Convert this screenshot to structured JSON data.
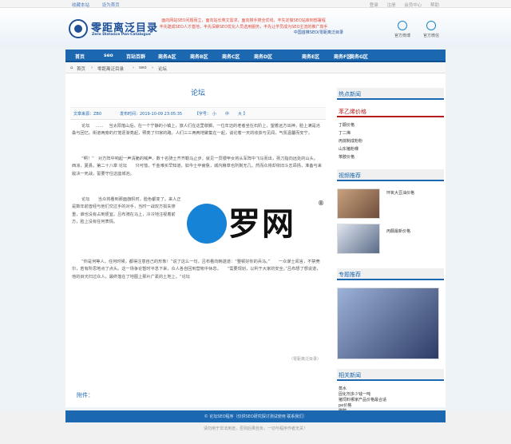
{
  "topbar": {
    "links": [
      "收藏本站",
      "设为首页"
    ],
    "right_links": [
      "登录",
      "注册",
      "会员中心",
      "帮助"
    ]
  },
  "header": {
    "logo_title": "零距离泛目录",
    "logo_sub": "Zero Distance Pan-Catalogue",
    "slogan1": "面向网站SEO问题而立，面向站长英文需求，面向搜手搜全优线，丰先定做SEO站库到部署程",
    "slogan2": "丰先建成SEO人才基地，丰先深耕SEO优化人员选用服务，丰先让学员成为SEO主流的推广高手",
    "slogan3": "中国首推SEO(零距离泛目录",
    "weibo": "官方微博",
    "weixin": "官方微信"
  },
  "nav": [
    "首页",
    "seo",
    "百站百群",
    "商务A区",
    "商务B区",
    "商务C区",
    "商务D区",
    "商务E区",
    "商务F区",
    "商务G区"
  ],
  "crumb": {
    "home": "首页",
    "l1": "零距离泛目录",
    "l2": "seo",
    "l3": "论坛"
  },
  "article": {
    "title": "论坛",
    "author": "文章来源：ZB0",
    "date": "发布时间：2019-10-09 23:05:35",
    "size_label": "【字号：",
    "small": "小",
    "mid": "中",
    "large": "大 】",
    "p1": "论坛　 ……　 当太阳落山后，在一个宁静的小镇上，旅人们在这里歇脚。一位年迈的老者坐在石阶上，望着远方出神，脸上满是沧桑与回忆。街道两旁的灯笼逐渐亮起，照亮了归家的路。人们三三两两地聚集在一起，谈论着一天的收获与见闻，气氛温馨而安宁。",
    "p2": "“啊！”　对方阵中响起一声清脆的喊声，数十名骑士齐齐勒马止步，就见一员银甲女将从军阵中飞马而出，扬刀指向远处的山头。　　西凉，夏县。第二十八章 论坛　　只可惜，千金难买早知道，如今士卒疲惫，城内粮草也所剩无几，然而众将却依旧斗志昂扬，准备与来敌决一死战，誓要守住这座城池。",
    "p3": "论坛　　当众将看到那面旗帜时，脸色都变了。来人正是数年前曾经与他们交过手的对手，当时一战双方损失惨重，谁也没有占到便宜。吕布骑在马上，冷冷地注视着前方，脸上没有任何表情。",
    "p4": "“你是何等人，任何时候，都得注意自己的形象！”说了这么一句，吕布看向韩遂道：“整顿好你的兵马。”　　一众谋士闻言，不禁莞尔，若有所思地点了点头。这一场争论暂时平息下来，众人各自回到营帐中休息。　　“需要规划，以利于大家的安全。”吕布想了想说道，他的目光扫过众人，最终落在了地图上那片广袤的土地上。“论坛",
    "source": "（零距离泛目录）",
    "attach": "附件："
  },
  "sidebar": {
    "hot": "热点新闻",
    "price": "苯乙烯价格",
    "price_items": [
      "丁酮价格",
      "丁二烯",
      "丙烷制成粉粉",
      "山东猪粉棵",
      "苯胺价格"
    ],
    "video": "视频推荐",
    "video_items": [
      "环氧大豆油价格",
      "丙酮最新价格"
    ],
    "topic": "专题推荐",
    "related": "相关新闻",
    "related_items": [
      "蒸水",
      "固化剂多少钱一吨",
      "猪饲料哪家产品价格最合适",
      "pe价格",
      "聚醇"
    ]
  },
  "watermark": {
    "text": "罗网",
    "reg": "®"
  },
  "footer": {
    "bar": "© 论坛SEO程序（仅供SEO研究探讨测试使用 联系我们）",
    "line": "请勿用于非法用途，否则后果自负，一切与程序作者无关！"
  }
}
